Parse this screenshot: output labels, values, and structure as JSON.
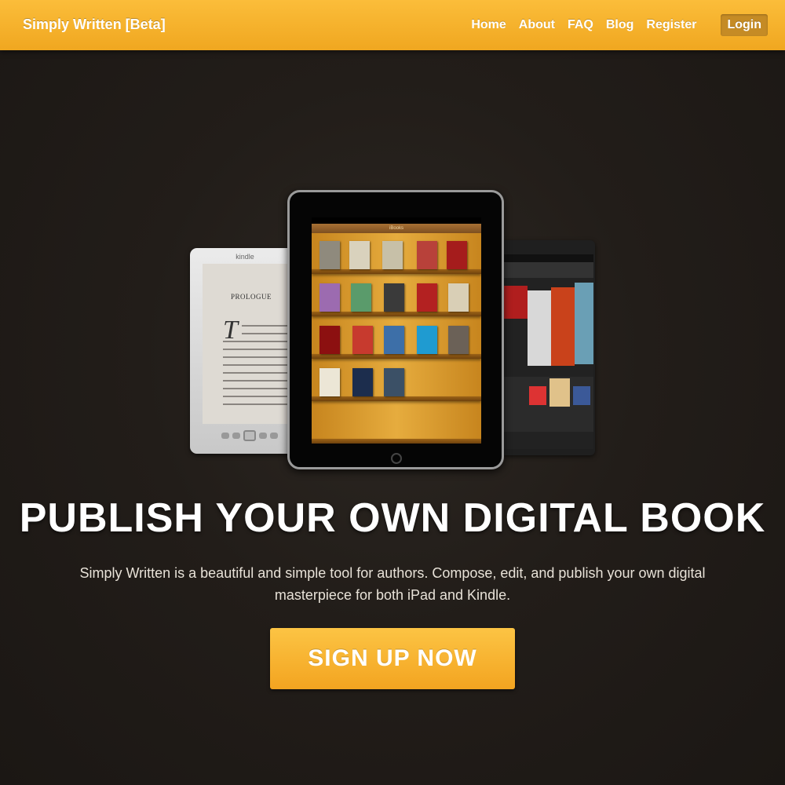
{
  "navbar": {
    "brand": "Simply Written [Beta]",
    "links": [
      "Home",
      "About",
      "FAQ",
      "Blog",
      "Register"
    ],
    "login": "Login",
    "color": "#f7b231"
  },
  "hero": {
    "kindle_logo": "kindle",
    "kindle_chapter": "PROLOGUE",
    "kindle_dropcap": "T",
    "ipad_app_title": "iBooks",
    "headline": "PUBLISH YOUR OWN DIGITAL BOOK",
    "tagline": "Simply Written is a beautiful and simple tool for authors. Compose, edit, and publish your own digital masterpiece for both iPad and Kindle.",
    "cta": "SIGN UP NOW",
    "cta_color": "#f7b231"
  }
}
